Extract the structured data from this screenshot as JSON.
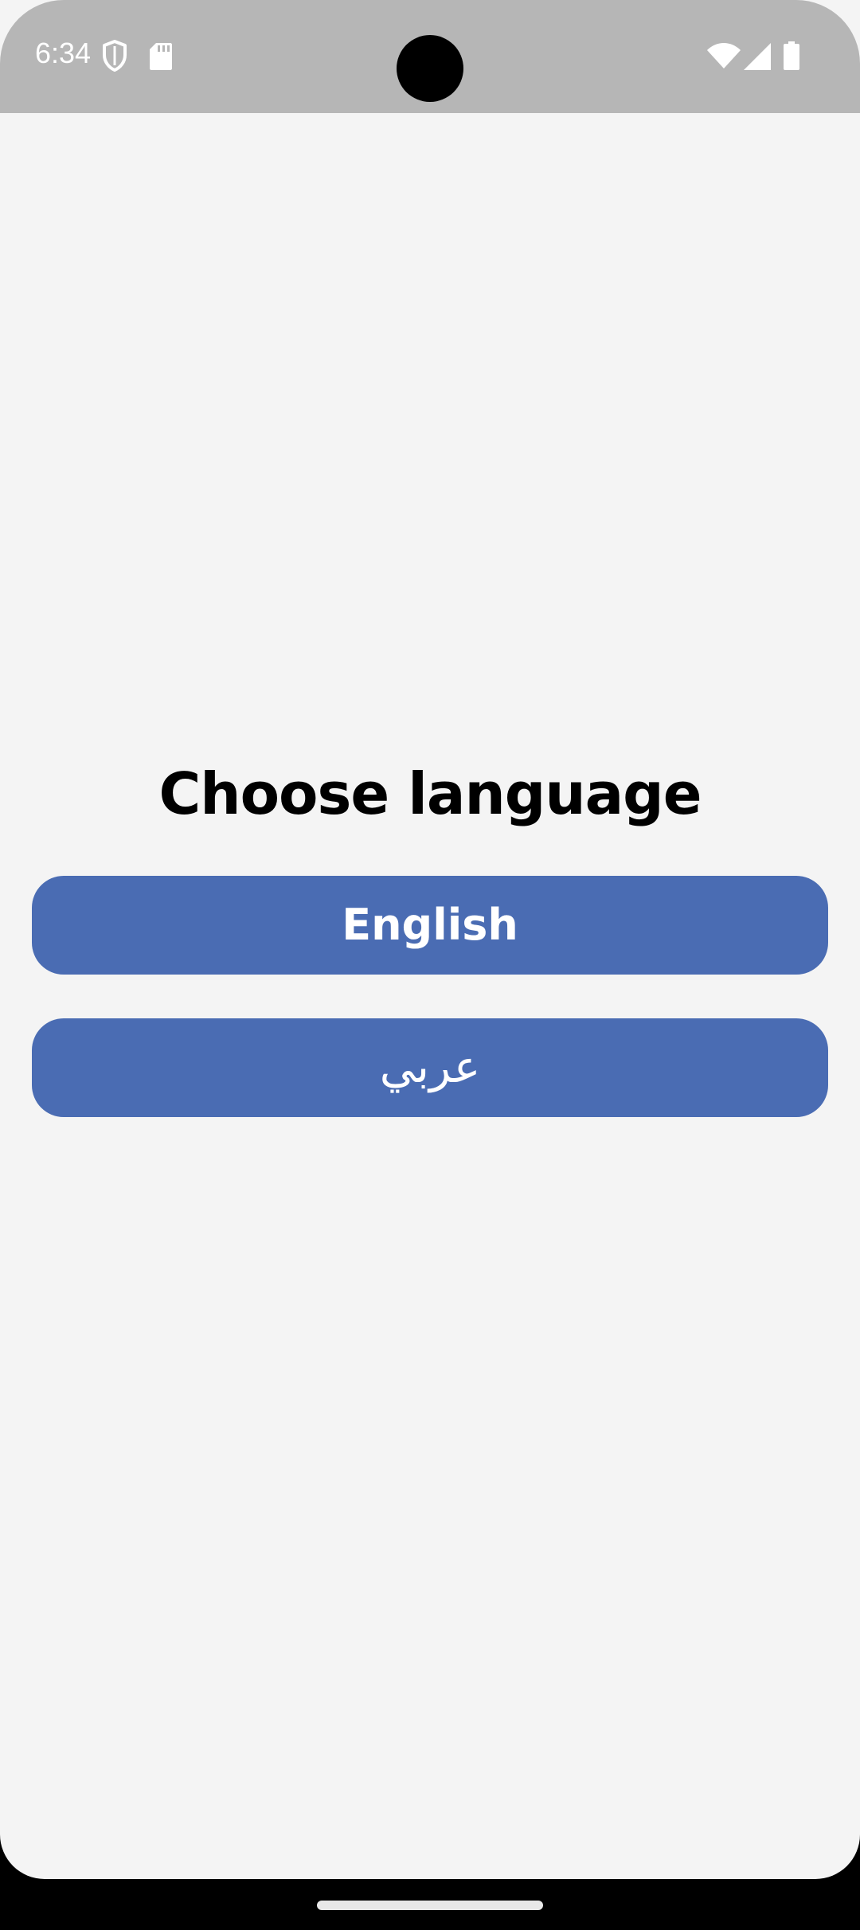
{
  "status_bar": {
    "time": "6:34",
    "left_icons": [
      "shield-icon",
      "sd-card-icon"
    ],
    "right_icons": [
      "wifi-icon",
      "cellular-signal-icon",
      "battery-icon"
    ]
  },
  "main": {
    "title": "Choose language",
    "buttons": [
      {
        "label": "English"
      },
      {
        "label": "عربي"
      }
    ]
  },
  "colors": {
    "background": "#f4f4f4",
    "status_bar": "#b6b6b6",
    "button": "#4a6cb3",
    "button_text": "#ffffff",
    "title_text": "#000000"
  }
}
